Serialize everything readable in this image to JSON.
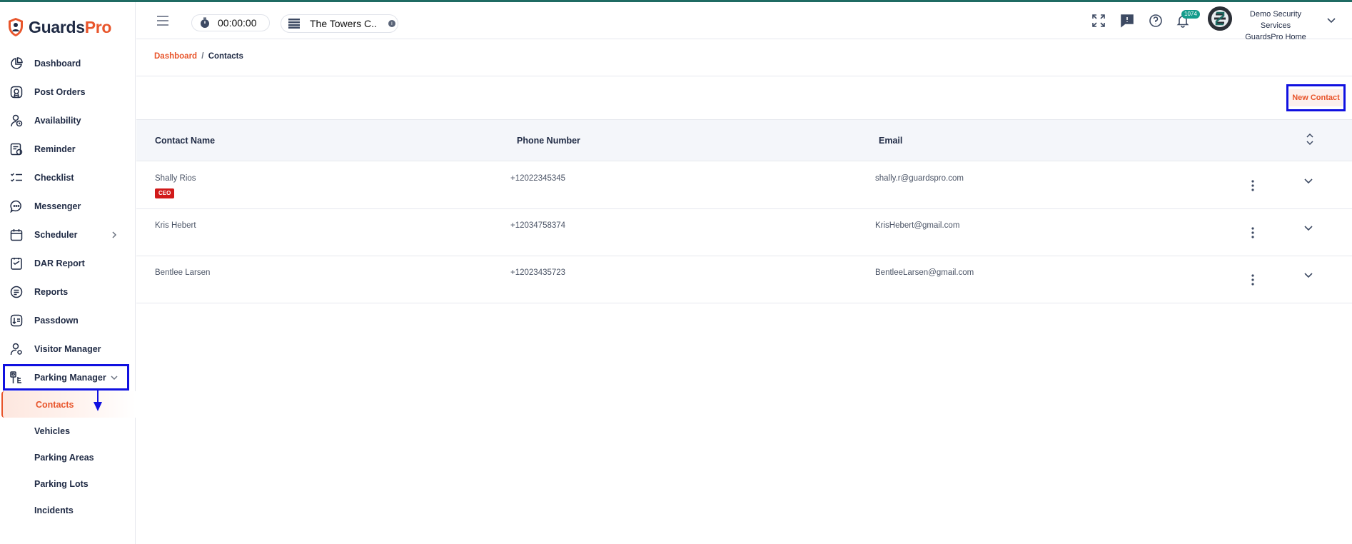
{
  "brand": {
    "name_part1": "Guards",
    "name_part2": "Pro",
    "accent": "#e8552b",
    "navy": "#1f2a44"
  },
  "sidebar": {
    "items": [
      {
        "label": "Dashboard",
        "icon": "pie-chart-icon"
      },
      {
        "label": "Post Orders",
        "icon": "badge-icon"
      },
      {
        "label": "Availability",
        "icon": "user-clock-icon"
      },
      {
        "label": "Reminder",
        "icon": "reminder-icon"
      },
      {
        "label": "Checklist",
        "icon": "checklist-icon"
      },
      {
        "label": "Messenger",
        "icon": "chat-bubble-icon"
      },
      {
        "label": "Scheduler",
        "icon": "calendar-icon",
        "has_children": true
      },
      {
        "label": "DAR Report",
        "icon": "report-icon"
      },
      {
        "label": "Reports",
        "icon": "document-icon"
      },
      {
        "label": "Passdown",
        "icon": "passdown-icon"
      },
      {
        "label": "Visitor Manager",
        "icon": "visitor-icon"
      },
      {
        "label": "Parking Manager",
        "icon": "parking-icon",
        "expanded": true
      }
    ],
    "sub_items": [
      {
        "label": "Contacts",
        "active": true
      },
      {
        "label": "Vehicles"
      },
      {
        "label": "Parking Areas"
      },
      {
        "label": "Parking Lots"
      },
      {
        "label": "Incidents"
      }
    ]
  },
  "header": {
    "timer": "00:00:00",
    "site_name": "The Towers C..",
    "notification_count": "1074",
    "org_name": "Demo Security Services",
    "org_home": "GuardsPro Home"
  },
  "breadcrumb": {
    "home": "Dashboard",
    "separator": "/",
    "current": "Contacts"
  },
  "toolbar": {
    "new_contact_label": "New Contact"
  },
  "table": {
    "columns": [
      "Contact Name",
      "Phone Number",
      "Email"
    ],
    "rows": [
      {
        "name": "Shally Rios",
        "role": "CEO",
        "phone": "+12022345345",
        "email": "shally.r@guardspro.com"
      },
      {
        "name": "Kris Hebert",
        "role": "",
        "phone": "+12034758374",
        "email": "KrisHebert@gmail.com"
      },
      {
        "name": "Bentlee Larsen",
        "role": "",
        "phone": "+12023435723",
        "email": "BentleeLarsen@gmail.com"
      }
    ]
  }
}
